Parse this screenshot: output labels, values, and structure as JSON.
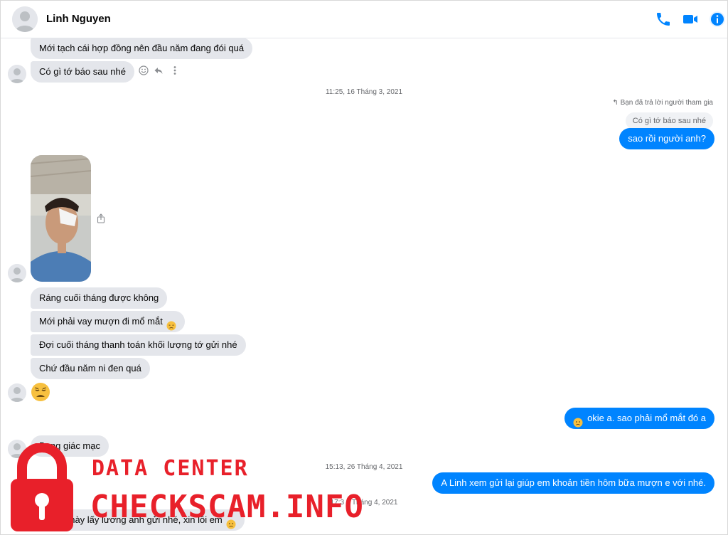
{
  "header": {
    "contact_name": "Linh Nguyen",
    "icons": [
      "phone-icon",
      "video-camera-icon",
      "info-icon"
    ],
    "accent_color": "#0084ff"
  },
  "messages": {
    "m1": "Mới tạch cái hợp đồng nên đầu năm đang đói quá",
    "m2": "Có gì tớ báo sau nhé",
    "ts1": "11:25, 16 Tháng 3, 2021",
    "reply_note": "Bạn đã trả lời người tham gia",
    "quoted": "Có gì tớ báo sau nhé",
    "out1": "sao rồi người anh?",
    "m3": "Ráng cuối tháng được không",
    "m4": "Mới phải vay mượn đi mổ mắt",
    "m5": "Đợi cuối tháng thanh toán khối lượng tớ gửi nhé",
    "m6": "Chứ đầu năm ni đen quá",
    "out2": "okie a. sao phải mổ mắt đó a",
    "m7": "Bong giác mạc",
    "ts2": "15:13, 26 Tháng 4, 2021",
    "out3": "A Linh xem gửi lại giúp em khoản tiền hôm bữa mượn e với nhé.",
    "ts3": "17:3 2 Tháng 4, 2021",
    "m8": "Có đợt này lấy lương anh gửi nhé, xin lỗi em"
  },
  "watermark": {
    "line1": "DATA CENTER",
    "line2": "CHECKSCAM.INFO",
    "color": "#e8202a"
  }
}
